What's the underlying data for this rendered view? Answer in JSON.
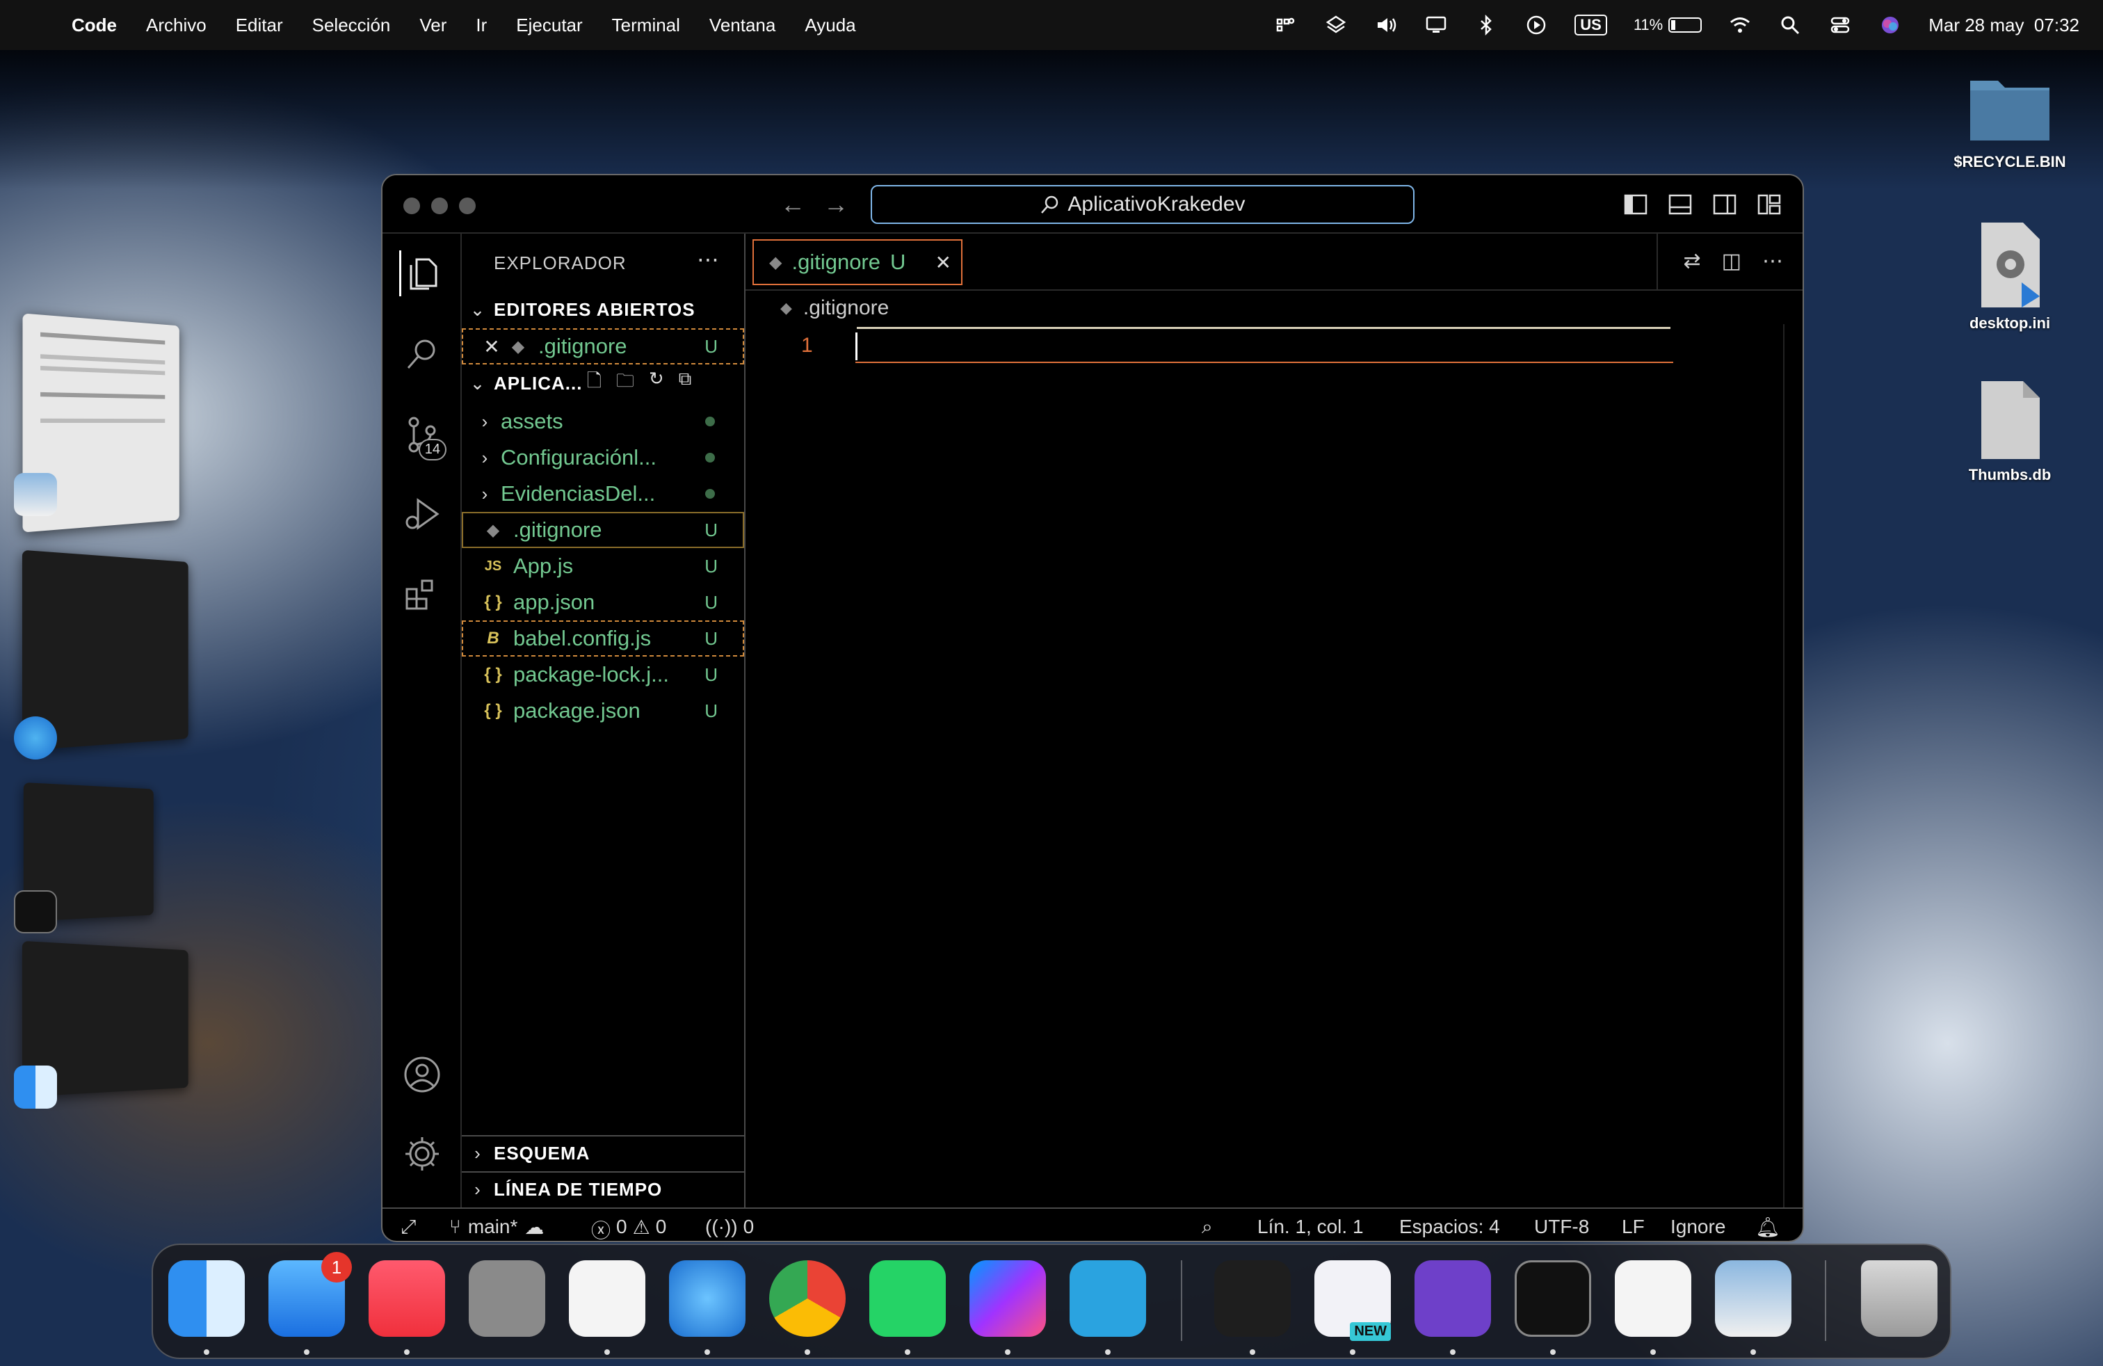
{
  "menubar": {
    "app": "Code",
    "items": [
      "Archivo",
      "Editar",
      "Selección",
      "Ver",
      "Ir",
      "Ejecutar",
      "Terminal",
      "Ventana",
      "Ayuda"
    ],
    "keyboard": "US",
    "battery": "11%",
    "datetime": "Mar 28 may  07:32"
  },
  "desktop": {
    "icons": [
      "$RECYCLE.BIN",
      "desktop.ini",
      "Thumbs.db"
    ]
  },
  "window": {
    "search": "AplicativoKrakedev",
    "explorer_title": "EXPLORADOR",
    "open_editors_title": "EDITORES ABIERTOS",
    "open_editor_file": ".gitignore",
    "open_editor_status": "U",
    "project_title": "APLICA...",
    "folders": [
      {
        "name": "assets"
      },
      {
        "name": "Configuraciónl..."
      },
      {
        "name": "EvidenciasDel..."
      }
    ],
    "files": [
      {
        "name": ".gitignore",
        "icon": "◆",
        "status": "U"
      },
      {
        "name": "App.js",
        "icon": "JS",
        "status": "U"
      },
      {
        "name": "app.json",
        "icon": "{ }",
        "status": "U"
      },
      {
        "name": "babel.config.js",
        "icon": "B",
        "status": "U"
      },
      {
        "name": "package-lock.j...",
        "icon": "{ }",
        "status": "U"
      },
      {
        "name": "package.json",
        "icon": "{ }",
        "status": "U"
      }
    ],
    "outline_title": "ESQUEMA",
    "timeline_title": "LÍNEA DE TIEMPO",
    "scm_badge": "14",
    "tab_label": ".gitignore",
    "tab_status": "U",
    "breadcrumb": ".gitignore",
    "line_number": "1",
    "status": {
      "branch": "main*",
      "errors": "0",
      "warnings": "0",
      "ports": "0",
      "position": "Lín. 1, col. 1",
      "spaces": "Espacios: 4",
      "encoding": "UTF-8",
      "eol": "LF",
      "language": "Ignore"
    }
  },
  "dock": {
    "mail_badge": "1",
    "teams_badge": "NEW"
  },
  "colors": {
    "accent": "#e0703a",
    "git_untracked": "#73c991",
    "focus_border": "#7fb6e8"
  }
}
